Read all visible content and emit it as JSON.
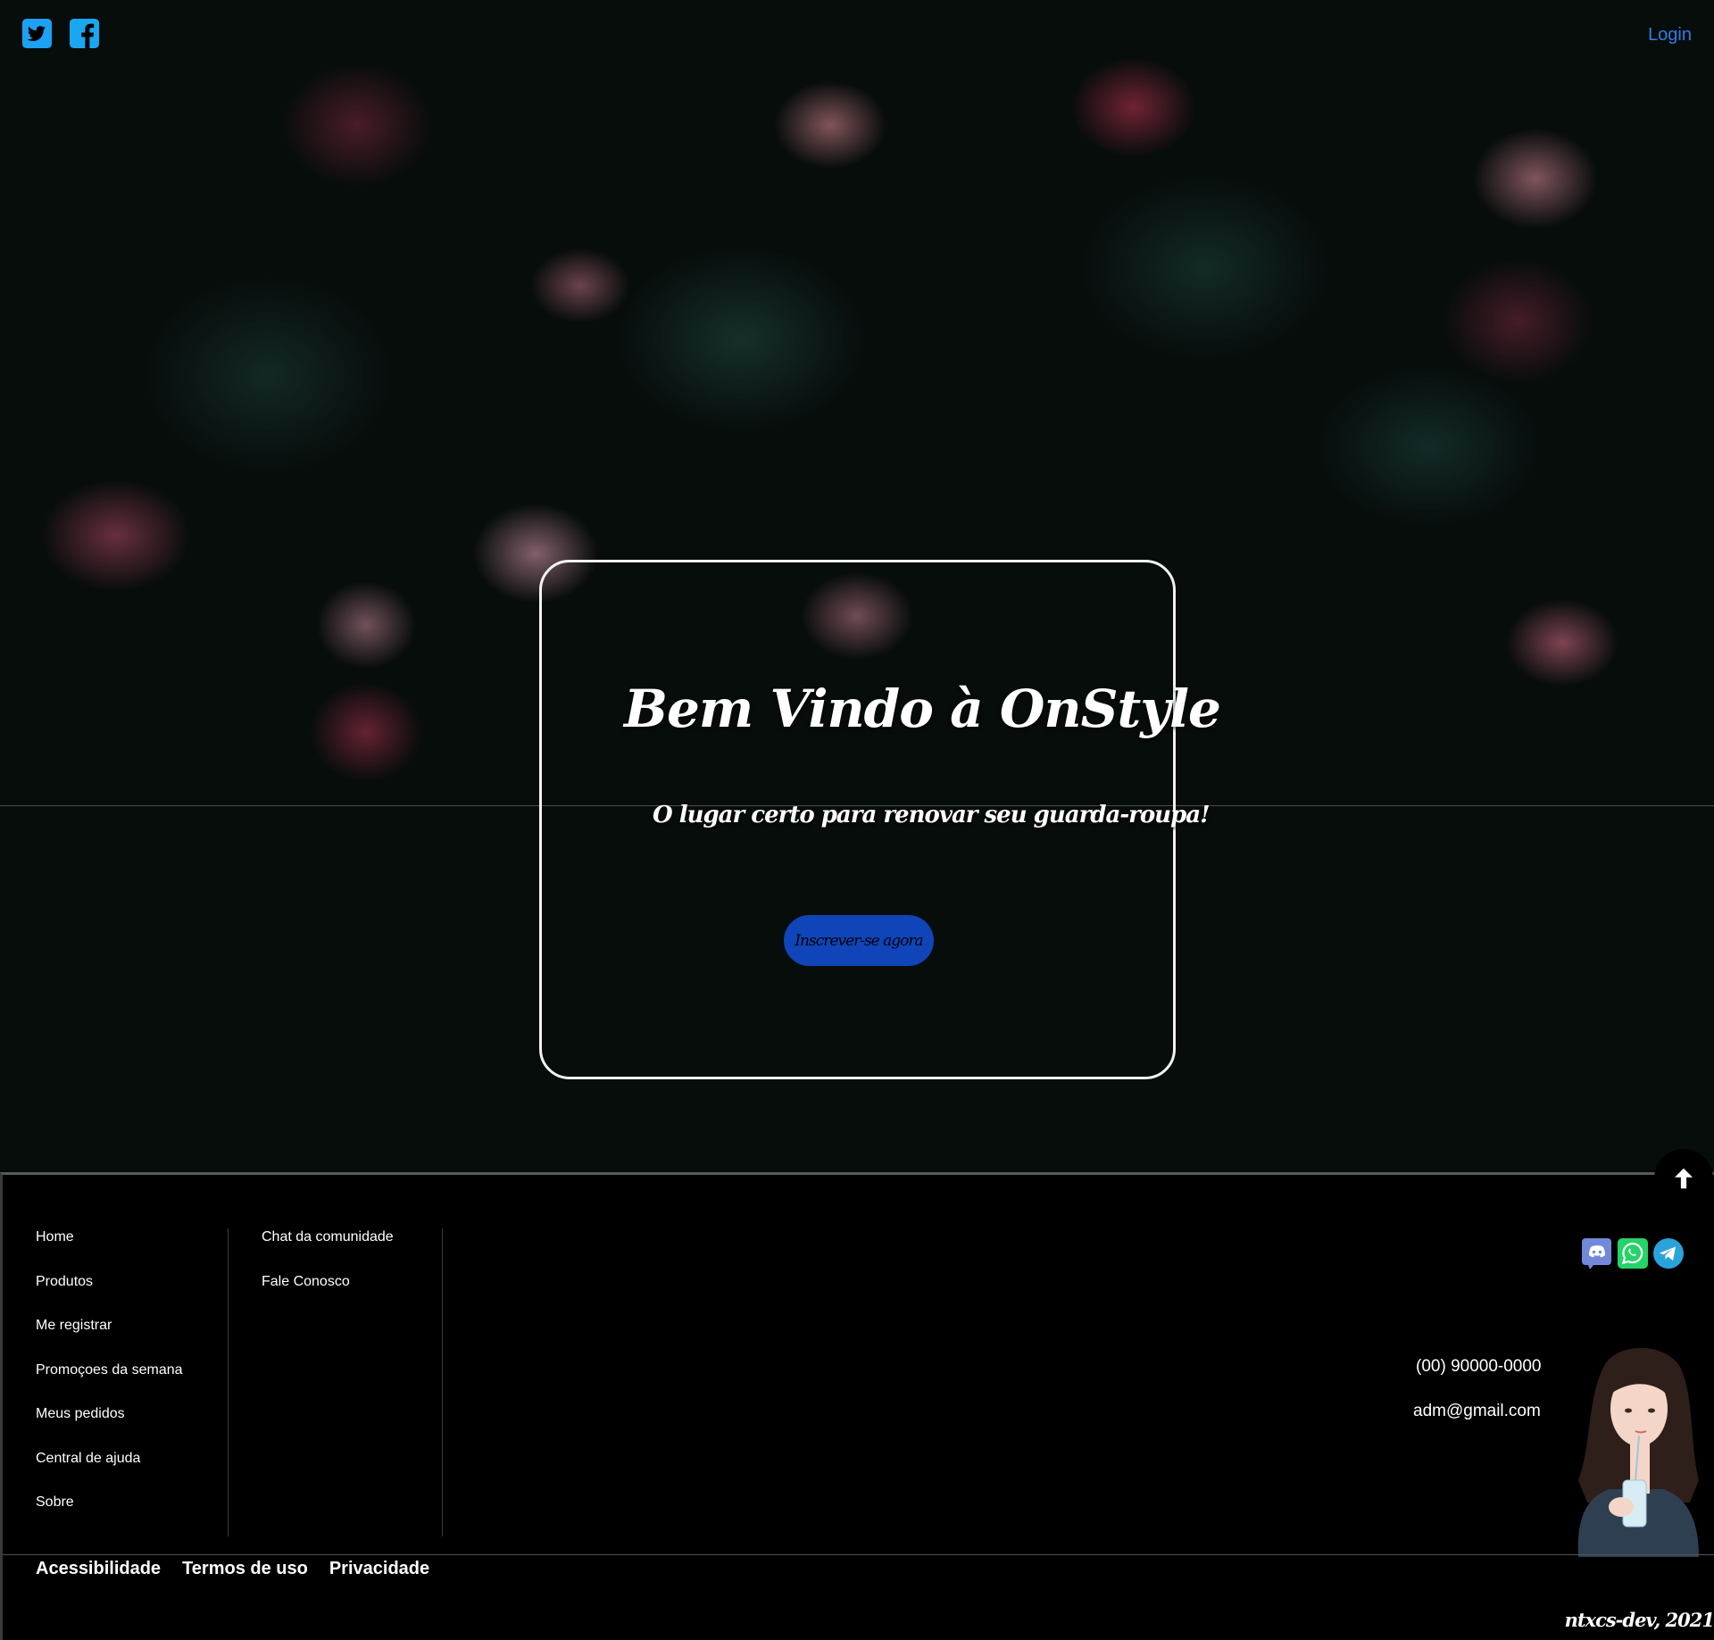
{
  "header": {
    "social": [
      {
        "name": "twitter-icon",
        "color": "#1da1f2"
      },
      {
        "name": "facebook-icon",
        "color": "#1877f2"
      }
    ],
    "login_label": "Login"
  },
  "hero": {
    "title": "Bem Vindo à OnStyle",
    "subtitle": "O lugar certo para renovar seu guarda-roupa!",
    "cta_label": "Inscrever-se agora",
    "cta_color": "#0f45b8"
  },
  "footer": {
    "nav_main": [
      "Home",
      "Produtos",
      "Me registrar",
      "Promoçoes da semana",
      "Meus pedidos",
      "Central de ajuda",
      "Sobre"
    ],
    "nav_secondary": [
      "Chat da comunidade",
      "Fale Conosco"
    ],
    "community_icons": [
      "discord-icon",
      "whatsapp-icon",
      "telegram-icon"
    ],
    "phone": "(00) 90000-0000",
    "email": "adm@gmail.com",
    "bottom_links": [
      "Acessibilidade",
      "Termos de uso",
      "Privacidade"
    ],
    "signature": "ntxcs-dev, 2021"
  }
}
